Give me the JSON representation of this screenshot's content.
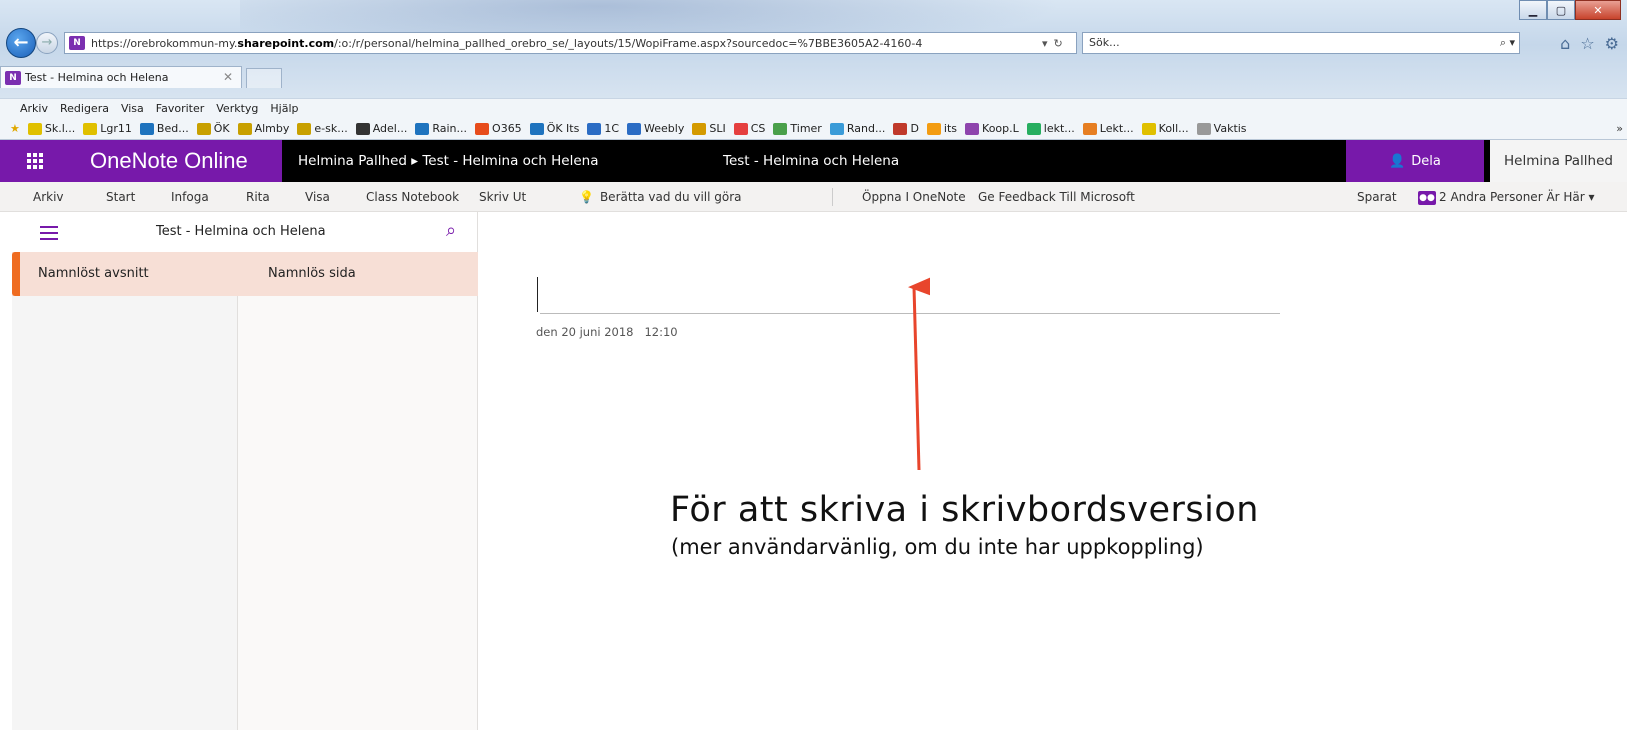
{
  "browser": {
    "address_url_prefix": "https://orebrokommun-my.",
    "address_url_host": "sharepoint.com",
    "address_url_path": "/:o:/r/personal/helmina_pallhed_orebro_se/_layouts/15/WopiFrame.aspx?sourcedoc=%7BBE3605A2-4160-4",
    "search_placeholder": "Sök...",
    "tab_title": "Test - Helmina och Helena",
    "menu": [
      "Arkiv",
      "Redigera",
      "Visa",
      "Favoriter",
      "Verktyg",
      "Hjälp"
    ],
    "favorites": [
      {
        "label": "Sk.l...",
        "color": "#e0c000"
      },
      {
        "label": "Lgr11",
        "color": "#e0c000"
      },
      {
        "label": "Bed...",
        "color": "#1e73be"
      },
      {
        "label": "ÖK",
        "color": "#c8a000"
      },
      {
        "label": "Almby",
        "color": "#c8a000"
      },
      {
        "label": "e-sk...",
        "color": "#c8a000"
      },
      {
        "label": "Adel...",
        "color": "#333333"
      },
      {
        "label": "Rain...",
        "color": "#1e73be"
      },
      {
        "label": "O365",
        "color": "#e74c1c"
      },
      {
        "label": "ÖK Its",
        "color": "#1e73be"
      },
      {
        "label": "1C",
        "color": "#2b6cc4"
      },
      {
        "label": "Weebly",
        "color": "#2b6cc4"
      },
      {
        "label": "SLI",
        "color": "#d49a00"
      },
      {
        "label": "CS",
        "color": "#e53f3f"
      },
      {
        "label": "Timer",
        "color": "#4aa04a"
      },
      {
        "label": "Rand...",
        "color": "#3a9bd8"
      },
      {
        "label": "D",
        "color": "#c0392b"
      },
      {
        "label": "its",
        "color": "#f39c12"
      },
      {
        "label": "Koop.L",
        "color": "#8e44ad"
      },
      {
        "label": "lekt...",
        "color": "#27ae60"
      },
      {
        "label": "Lekt...",
        "color": "#e67e22"
      },
      {
        "label": "Koll...",
        "color": "#e0c000"
      },
      {
        "label": "Vaktis",
        "color": "#999999"
      }
    ]
  },
  "header": {
    "app_name": "OneNote Online",
    "breadcrumb_owner": "Helmina Pallhed",
    "breadcrumb_separator": "▸",
    "breadcrumb_notebook": "Test - Helmina och Helena",
    "document_title": "Test - Helmina och Helena",
    "share_label": "Dela",
    "user_name": "Helmina Pallhed",
    "accent_color": "#7719aa"
  },
  "ribbon": {
    "tabs": [
      "Arkiv",
      "Start",
      "Infoga",
      "Rita",
      "Visa",
      "Class Notebook",
      "Skriv Ut"
    ],
    "tell_me": "Berätta vad du vill göra",
    "open_in_onenote": "Öppna I OneNote",
    "feedback": "Ge Feedback Till Microsoft",
    "status": "Sparat",
    "collaborators": "2 Andra Personer Är Här"
  },
  "navigation": {
    "notebook_title": "Test - Helmina och Helena",
    "sections": [
      "Namnlöst avsnitt"
    ],
    "pages": [
      "Namnlös sida"
    ]
  },
  "page": {
    "date": "den 20 juni 2018",
    "time": "12:10"
  },
  "annotation": {
    "heading": "För att skriva i skrivbordsversion",
    "subtext": "(mer användarvänlig, om du inte har uppkoppling)",
    "arrow_color": "#e8452c"
  }
}
